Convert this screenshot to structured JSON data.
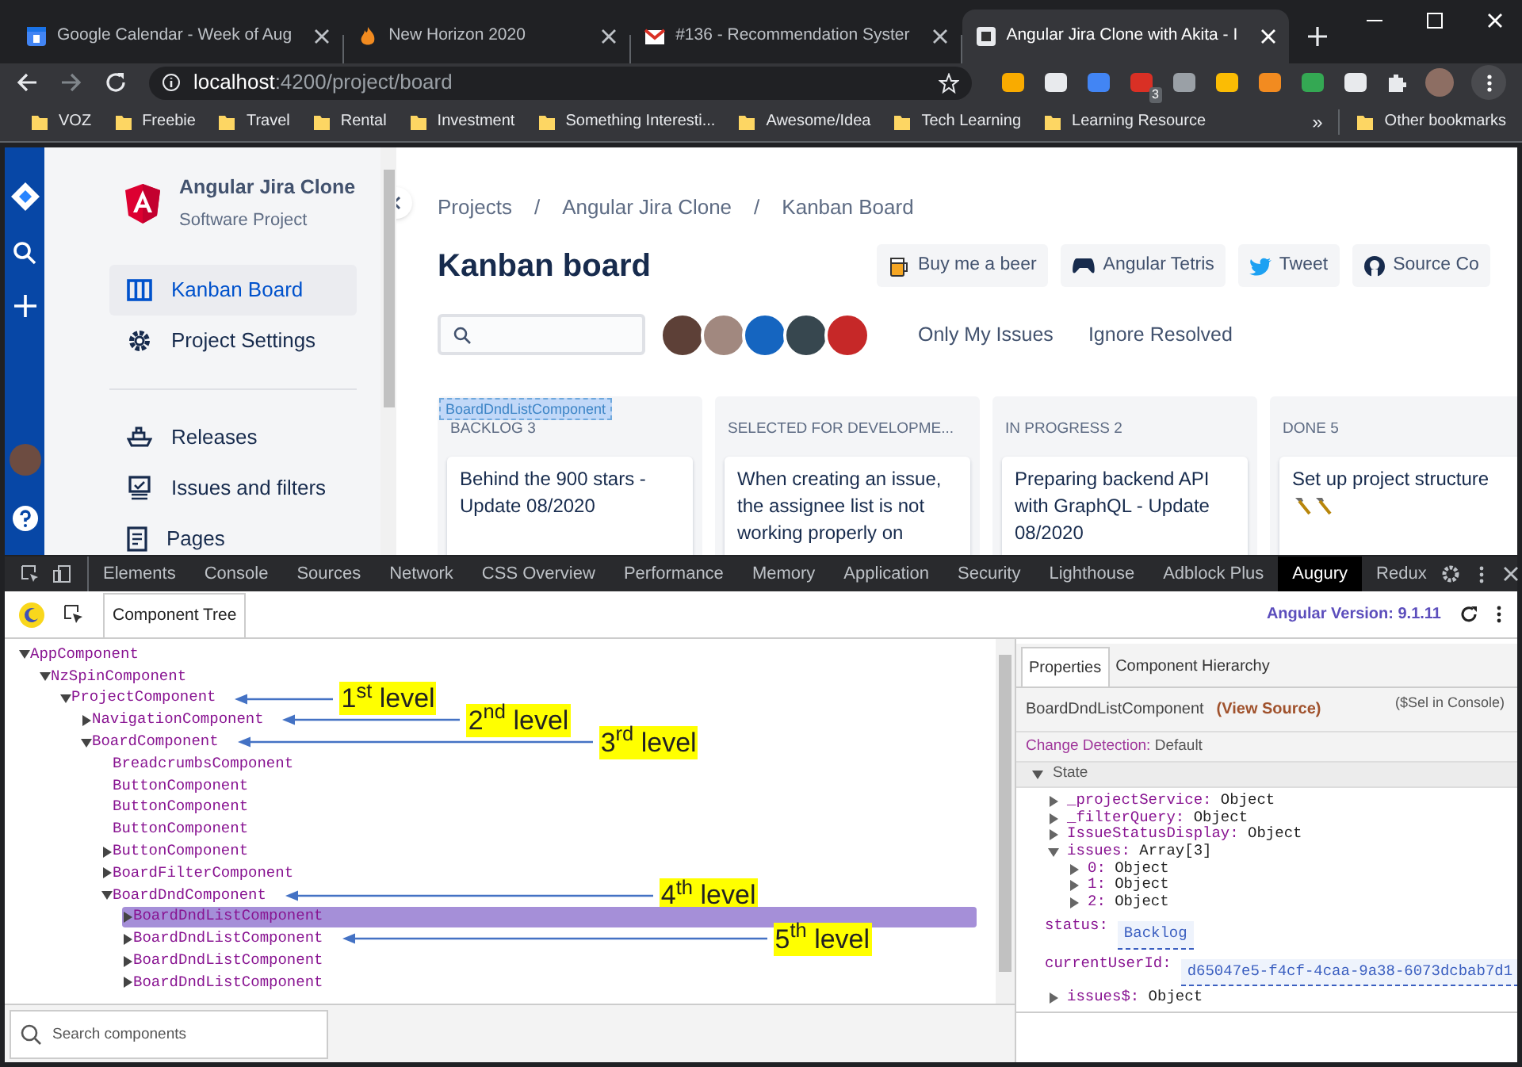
{
  "browser": {
    "tabs": [
      {
        "title": "Google Calendar - Week of Aug",
        "selected": false,
        "kind": "calendar"
      },
      {
        "title": "New Horizon 2020",
        "selected": false,
        "kind": "fire"
      },
      {
        "title": "#136 - Recommendation Syster",
        "selected": false,
        "kind": "mail"
      },
      {
        "title": "Angular Jira Clone with Akita - I",
        "selected": true,
        "kind": "app"
      }
    ],
    "address": {
      "host": "localhost",
      "path": ":4200/project/board"
    },
    "extension_badge": "3",
    "bookmarks": [
      "VOZ",
      "Freebie",
      "Travel",
      "Rental",
      "Investment",
      "Something Interesti...",
      "Awesome/Idea",
      "Tech Learning",
      "Learning Resource"
    ],
    "bookmarks_overflow": "»",
    "other_bookmarks": "Other bookmarks"
  },
  "app": {
    "project": {
      "name": "Angular Jira Clone",
      "type": "Software Project"
    },
    "nav": [
      {
        "label": "Kanban Board",
        "selected": true,
        "kind": "board"
      },
      {
        "label": "Project Settings",
        "selected": false,
        "kind": "settings"
      }
    ],
    "nav_secondary": [
      {
        "label": "Releases",
        "kind": "ship"
      },
      {
        "label": "Issues and filters",
        "kind": "monitor"
      },
      {
        "label": "Pages",
        "kind": "page"
      }
    ],
    "breadcrumbs": [
      "Projects",
      "Angular Jira Clone",
      "Kanban Board"
    ],
    "breadcrumb_separator": "/",
    "title": "Kanban board",
    "buttons": [
      {
        "label": "Buy me a beer",
        "kind": "beer"
      },
      {
        "label": "Angular Tetris",
        "kind": "gamepad"
      },
      {
        "label": "Tweet",
        "kind": "bird"
      },
      {
        "label": "Source Co",
        "kind": "github"
      }
    ],
    "filters": [
      "Only My Issues",
      "Ignore Resolved"
    ],
    "inspect_label": "BoardDndListComponent",
    "columns": [
      {
        "title": "BACKLOG 3",
        "cards": [
          {
            "title": "Behind the 900 stars - Update 08/2020"
          }
        ]
      },
      {
        "title": "SELECTED FOR DEVELOPME...",
        "cards": [
          {
            "title": "When creating an issue, the assignee list is not working properly on"
          }
        ]
      },
      {
        "title": "IN PROGRESS 2",
        "cards": [
          {
            "title": "Preparing backend API with GraphQL - Update 08/2020"
          }
        ]
      },
      {
        "title": "DONE 5",
        "cards": [
          {
            "title": "Set up project structure",
            "hammers": true
          }
        ]
      }
    ]
  },
  "devtools": {
    "tabs": [
      {
        "label": "Elements",
        "selected": false
      },
      {
        "label": "Console",
        "selected": false
      },
      {
        "label": "Sources",
        "selected": false
      },
      {
        "label": "Network",
        "selected": false
      },
      {
        "label": "CSS Overview",
        "selected": false
      },
      {
        "label": "Performance",
        "selected": false
      },
      {
        "label": "Memory",
        "selected": false
      },
      {
        "label": "Application",
        "selected": false
      },
      {
        "label": "Security",
        "selected": false
      },
      {
        "label": "Lighthouse",
        "selected": false
      },
      {
        "label": "Adblock Plus",
        "selected": false
      },
      {
        "label": "Augury",
        "selected": true
      },
      {
        "label": "Redux",
        "selected": false
      }
    ],
    "augury": {
      "tab": "Component Tree",
      "version_label": "Angular Version: 9.1.11",
      "tree": [
        {
          "name": "AppComponent",
          "kind": "branch",
          "expanded": true,
          "selected": false,
          "children": [
            {
              "name": "NzSpinComponent",
              "kind": "branch",
              "expanded": true,
              "selected": false,
              "children": [
                {
                  "name": "ProjectComponent",
                  "kind": "branch",
                  "expanded": true,
                  "selected": false,
                  "annotation": "1$^{st}$ level",
                  "children": [
                    {
                      "name": "NavigationComponent",
                      "kind": "branch",
                      "expanded": false,
                      "selected": false,
                      "annotation": "2$^{nd}$ level"
                    },
                    {
                      "name": "BoardComponent",
                      "kind": "branch",
                      "expanded": true,
                      "selected": false,
                      "annotation": "3$^{rd}$ level",
                      "children": [
                        {
                          "name": "BreadcrumbsComponent",
                          "kind": "leaf",
                          "selected": false
                        },
                        {
                          "name": "ButtonComponent",
                          "kind": "leaf",
                          "selected": false
                        },
                        {
                          "name": "ButtonComponent",
                          "kind": "leaf",
                          "selected": false
                        },
                        {
                          "name": "ButtonComponent",
                          "kind": "leaf",
                          "selected": false
                        },
                        {
                          "name": "ButtonComponent",
                          "kind": "branch",
                          "expanded": false,
                          "selected": false
                        },
                        {
                          "name": "BoardFilterComponent",
                          "kind": "branch",
                          "expanded": false,
                          "selected": false
                        },
                        {
                          "name": "BoardDndComponent",
                          "kind": "branch",
                          "expanded": true,
                          "selected": false,
                          "annotation": "4$^{th}$ level",
                          "children": [
                            {
                              "name": "BoardDndListComponent",
                              "kind": "branch",
                              "expanded": false,
                              "selected": true
                            },
                            {
                              "name": "BoardDndListComponent",
                              "kind": "branch",
                              "expanded": false,
                              "selected": false,
                              "annotation": "5$^{th}$ level"
                            },
                            {
                              "name": "BoardDndListComponent",
                              "kind": "branch",
                              "expanded": false,
                              "selected": false
                            },
                            {
                              "name": "BoardDndListComponent",
                              "kind": "branch",
                              "expanded": false,
                              "selected": false
                            }
                          ]
                        }
                      ]
                    }
                  ]
                }
              ]
            }
          ]
        }
      ],
      "search_placeholder": "Search components",
      "panel_tabs": [
        {
          "label": "Properties",
          "selected": true
        },
        {
          "label": "Component Hierarchy",
          "selected": false
        }
      ],
      "component": "BoardDndListComponent",
      "view_source": "(View Source)",
      "console_hint": "($Sel in Console)",
      "change_detection": {
        "label": "Change Detection:",
        "value": "Default"
      },
      "state_label": "State",
      "state": [
        {
          "key": "_projectService:",
          "value": "Object",
          "kind": "node",
          "expanded": false
        },
        {
          "key": "_filterQuery:",
          "value": "Object",
          "kind": "node",
          "expanded": false
        },
        {
          "key": "IssueStatusDisplay:",
          "value": "Object",
          "kind": "node",
          "expanded": false
        },
        {
          "key": "issues:",
          "value": "Array[3]",
          "kind": "node",
          "expanded": true,
          "children": [
            {
              "key": "0:",
              "value": "Object",
              "kind": "node",
              "expanded": false
            },
            {
              "key": "1:",
              "value": "Object",
              "kind": "node",
              "expanded": false
            },
            {
              "key": "2:",
              "value": "Object",
              "kind": "node",
              "expanded": false
            }
          ]
        },
        {
          "key": "status:",
          "value": "Backlog",
          "kind": "field"
        },
        {
          "key": "currentUserId:",
          "value": "d65047e5-f4cf-4caa-9a38-6073dcbab7d1",
          "kind": "field"
        },
        {
          "key": "issues$:",
          "value": "Object",
          "kind": "node",
          "expanded": false
        }
      ]
    }
  }
}
